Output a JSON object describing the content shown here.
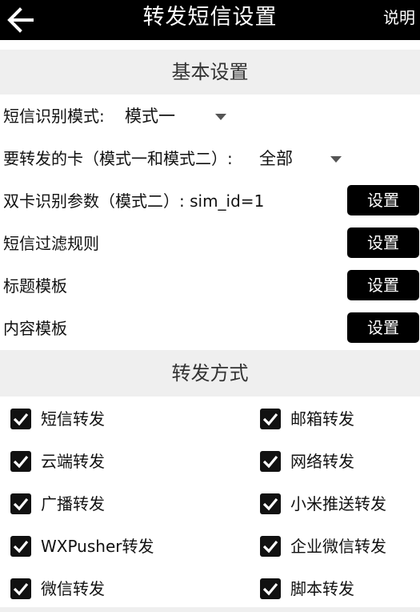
{
  "header": {
    "title": "转发短信设置",
    "help_label": "说明"
  },
  "basic": {
    "section_title": "基本设置",
    "sms_mode_label": "短信识别模式:",
    "sms_mode_value": "模式一",
    "card_label": "要转发的卡（模式一和模式二）:",
    "card_value": "全部",
    "dual_sim_label": "双卡识别参数（模式二）: sim_id=1",
    "filter_label": "短信过滤规则",
    "title_tpl_label": "标题模板",
    "content_tpl_label": "内容模板",
    "set_button": "设置"
  },
  "forward": {
    "section_title": "转发方式",
    "options": [
      {
        "label": "短信转发",
        "checked": true
      },
      {
        "label": "邮箱转发",
        "checked": true
      },
      {
        "label": "云端转发",
        "checked": true
      },
      {
        "label": "网络转发",
        "checked": true
      },
      {
        "label": "广播转发",
        "checked": true
      },
      {
        "label": "小米推送转发",
        "checked": true
      },
      {
        "label": "WXPusher转发",
        "checked": true
      },
      {
        "label": "企业微信转发",
        "checked": true
      },
      {
        "label": "微信转发",
        "checked": true
      },
      {
        "label": "脚本转发",
        "checked": true
      }
    ]
  },
  "colors": {
    "topbar": "#000000",
    "section_bg": "#efefef",
    "button_bg": "#000000"
  }
}
